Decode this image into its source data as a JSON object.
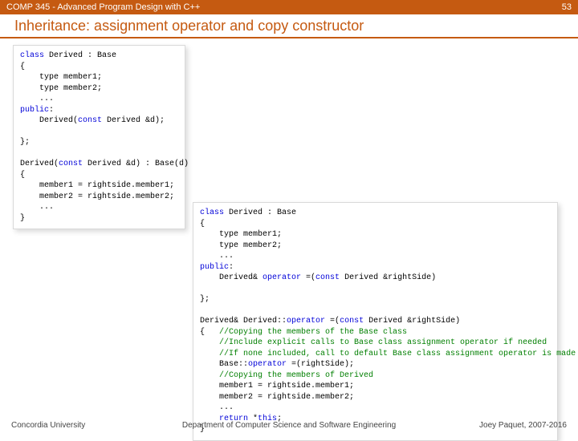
{
  "header": {
    "course": "COMP 345 - Advanced Program Design with C++",
    "page_number": "53"
  },
  "title": "Inheritance: assignment operator and copy constructor",
  "code_left": {
    "l1a": "class",
    "l1b": " Derived : Base",
    "l2": "{",
    "l3": "    type member1;",
    "l4": "    type member2;",
    "l5": "    ...",
    "l6a": "public",
    "l6b": ":",
    "l7a": "    Derived(",
    "l7b": "const",
    "l7c": " Derived &d);",
    "l8": "",
    "l9": "};",
    "l10": "",
    "l11a": "Derived(",
    "l11b": "const",
    "l11c": " Derived &d) : Base(d)",
    "l12": "{",
    "l13": "    member1 = rightside.member1;",
    "l14": "    member2 = rightside.member2;",
    "l15": "    ...",
    "l16": "}"
  },
  "code_right": {
    "l1a": "class",
    "l1b": " Derived : Base",
    "l2": "{",
    "l3": "    type member1;",
    "l4": "    type member2;",
    "l5": "    ...",
    "l6a": "public",
    "l6b": ":",
    "l7a": "    Derived& ",
    "l7b": "operator",
    "l7c": " =(",
    "l7d": "const",
    "l7e": " Derived &rightSide)",
    "l8": "",
    "l9": "};",
    "l10": "",
    "l11a": "Derived& Derived::",
    "l11b": "operator",
    "l11c": " =(",
    "l11d": "const",
    "l11e": " Derived &rightSide)",
    "l12a": "{   ",
    "l12b": "//Copying the members of the Base class",
    "l13": "    //Include explicit calls to Base class assignment operator if needed",
    "l14": "    //If none included, call to default Base class assignment operator is made",
    "l15a": "    Base::",
    "l15b": "operator",
    "l15c": " =(rightSide);",
    "l16": "    //Copying the members of Derived",
    "l17": "    member1 = rightside.member1;",
    "l18": "    member2 = rightside.member2;",
    "l19": "    ...",
    "l20a": "    ",
    "l20b": "return",
    "l20c": " *",
    "l20d": "this",
    "l20e": ";",
    "l21": "}"
  },
  "footer": {
    "left": "Concordia University",
    "center": "Department of Computer Science and Software Engineering",
    "right": "Joey Paquet, 2007-2016"
  }
}
